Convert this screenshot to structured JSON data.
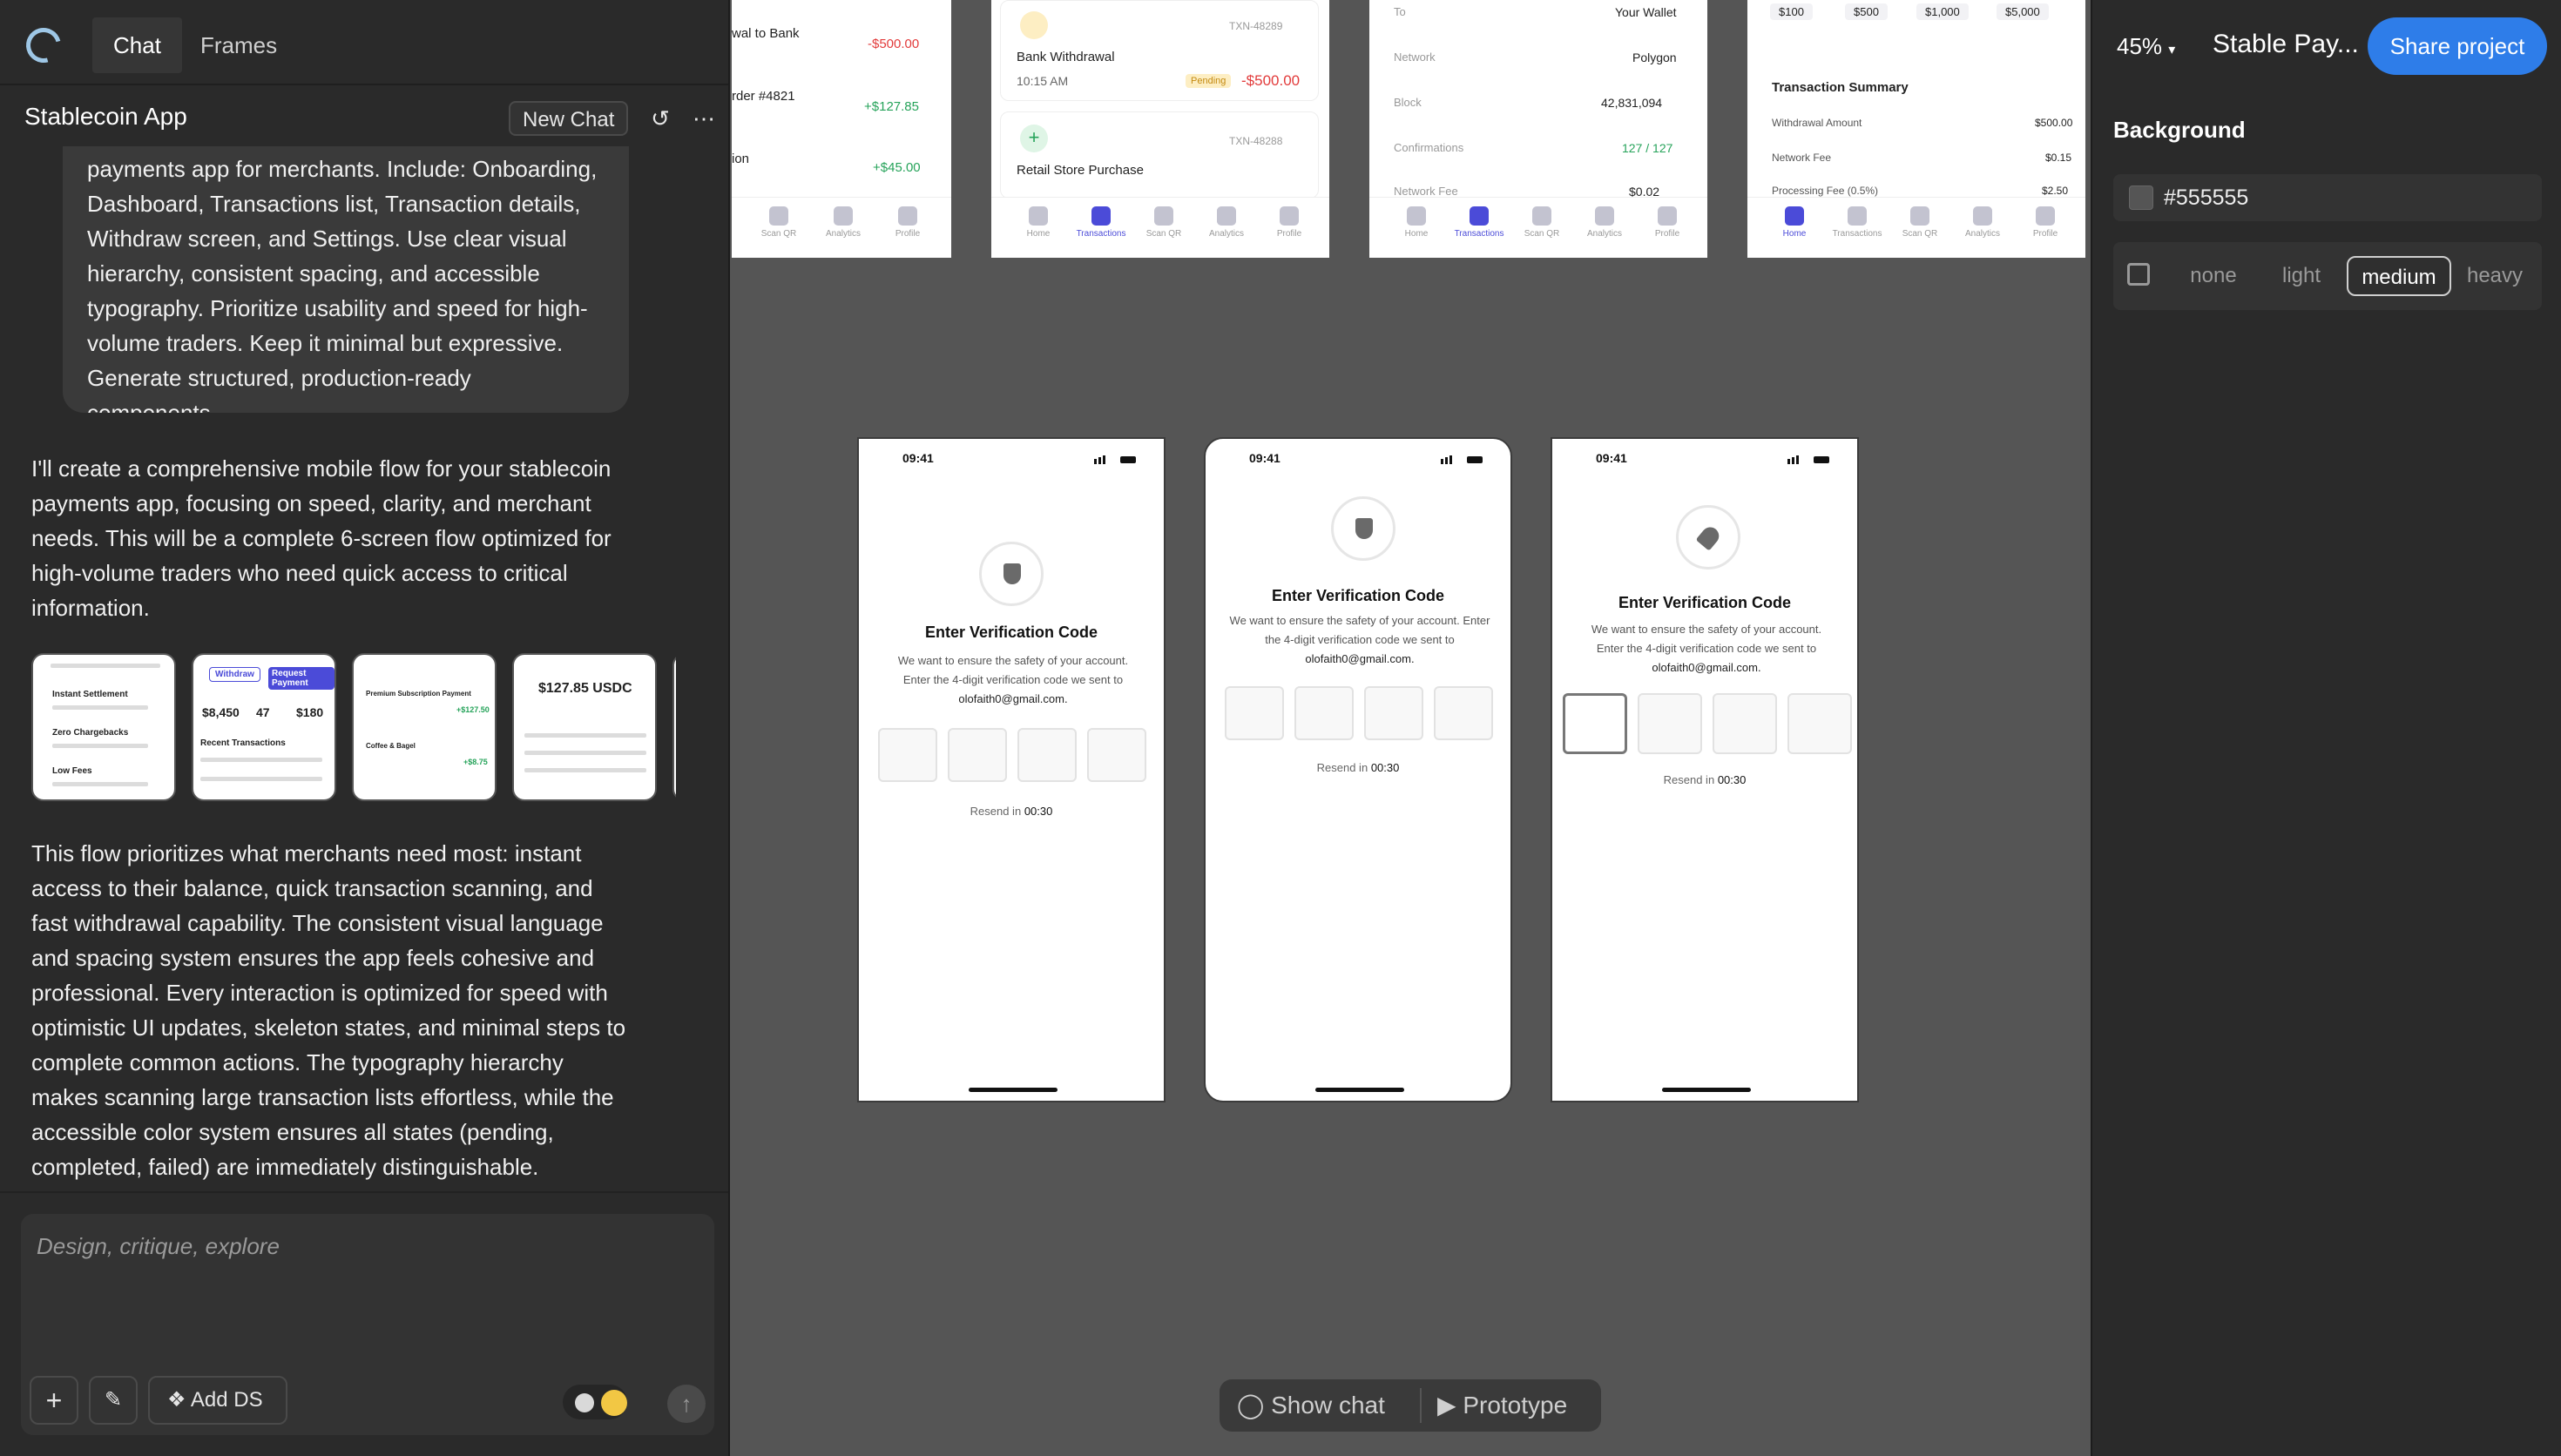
{
  "tabs": {
    "chat": "Chat",
    "frames": "Frames"
  },
  "chat": {
    "title": "Stablecoin App",
    "new_chat": "New Chat",
    "user_prompt_lines": [
      "payments app for merchants. Include: Onboarding,",
      "Dashboard, Transactions list, Transaction details,",
      "Withdraw screen, and Settings. Use clear visual",
      "hierarchy, consistent spacing, and accessible",
      "typography. Prioritize usability and speed for high-",
      "volume traders. Keep it minimal but expressive.",
      "Generate structured, production-ready components."
    ],
    "reply1_lines": [
      "I'll create a comprehensive mobile flow for your stablecoin",
      "payments app, focusing on speed, clarity, and merchant",
      "needs. This will be a complete 6-screen flow optimized for",
      "high-volume traders who need quick access to critical",
      "information."
    ],
    "reply2_lines": [
      "This flow prioritizes what merchants need most: instant",
      "access to their balance, quick transaction scanning, and",
      "fast withdrawal capability. The consistent visual language",
      "and spacing system ensures the app feels cohesive and",
      "professional. Every interaction is optimized for speed with",
      "optimistic UI updates, skeleton states, and minimal steps to",
      "complete common actions. The typography hierarchy",
      "makes scanning large transaction lists effortless, while the",
      "accessible color system ensures all states (pending,",
      "completed, failed) are immediately distinguishable."
    ],
    "thumbs": {
      "t1_a": "Instant Settlement",
      "t1_b": "Zero Chargebacks",
      "t1_c": "Low Fees",
      "t2_a": "Withdraw",
      "t2_b": "Request Payment",
      "t2_c": "$8,450",
      "t2_d": "47",
      "t2_e": "$180",
      "t2_f": "Recent Transactions",
      "t3_a": "Premium Subscription Payment",
      "t3_b": "+$127.50",
      "t3_c": "Coffee & Bagel",
      "t3_d": "+$8.75",
      "t4_a": "$127.85 USDC"
    },
    "composer_placeholder": "Design, critique, explore",
    "add_ds": "Add DS"
  },
  "canvas": {
    "top_frames": {
      "f1": {
        "r1": "wal to Bank",
        "r1v": "-$500.00",
        "r2": "rder #4821",
        "r2v": "+$127.85",
        "r3": "ion",
        "r3v": "+$45.00"
      },
      "f2": {
        "id1": "TXN-48289",
        "r1": "Bank Withdrawal",
        "t1": "10:15 AM",
        "badge": "Pending",
        "v1": "-$500.00",
        "id2": "TXN-48288",
        "r2": "Retail Store Purchase"
      },
      "f3": {
        "to": "To",
        "to_v": "Your Wallet",
        "net": "Network",
        "net_v": "Polygon",
        "block": "Block",
        "block_v": "42,831,094",
        "conf": "Confirmations",
        "conf_v": "127 / 127",
        "fee": "Network Fee",
        "fee_v": "$0.02"
      },
      "f4": {
        "a1": "$100",
        "a2": "$500",
        "a3": "$1,000",
        "a4": "$5,000",
        "sum": "Transaction Summary",
        "wa": "Withdrawal Amount",
        "wa_v": "$500.00",
        "nf": "Network Fee",
        "nf_v": "$0.15",
        "pf": "Processing Fee (0.5%)",
        "pf_v": "$2.50"
      }
    },
    "nav": {
      "home": "Home",
      "transactions": "Transactions",
      "scan": "Scan QR",
      "analytics": "Analytics",
      "profile": "Profile"
    },
    "screens": [
      {
        "time": "09:41",
        "title": "Enter Verification Code",
        "line1": "We want to ensure the safety of your account.",
        "line2": "Enter the 4-digit verification code we sent to",
        "email": "olofaith0@gmail.com.",
        "resend": "Resend in",
        "timer": "00:30"
      },
      {
        "time": "09:41",
        "title": "Enter Verification Code",
        "line1": "We want to ensure the safety of your account. Enter",
        "line2": "the 4-digit verification code we sent to",
        "email": "olofaith0@gmail.com.",
        "resend": "Resend in",
        "timer": "00:30"
      },
      {
        "time": "09:41",
        "title": "Enter Verification Code",
        "line1": "We want to ensure the safety of your account.",
        "line2": "Enter the 4-digit verification code we sent to",
        "email": "olofaith0@gmail.com.",
        "resend": "Resend in",
        "timer": "00:30"
      }
    ],
    "show_chat": "Show chat",
    "prototype": "Prototype"
  },
  "right": {
    "zoom": "45%",
    "project": "Stable Pay...",
    "share": "Share project",
    "background_label": "Background",
    "background_hex": "#555555",
    "shadow_options": [
      "none",
      "light",
      "medium",
      "heavy"
    ],
    "shadow_selected": "medium"
  }
}
